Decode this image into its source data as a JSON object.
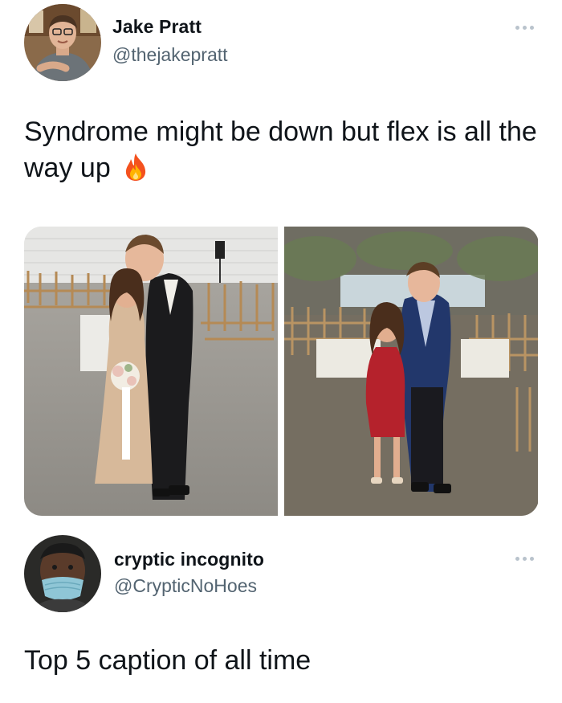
{
  "tweets": [
    {
      "author": {
        "name": "Jake Pratt",
        "handle": "@thejakepratt",
        "avatar_icon": "profile-photo"
      },
      "text": "Syndrome might be down but flex is all the way up",
      "text_emoji": "fire-emoji",
      "media": [
        {
          "icon": "photo-couple-tux-gold-dress"
        },
        {
          "icon": "photo-couple-blue-suit-red-dress"
        }
      ]
    },
    {
      "author": {
        "name": "cryptic incognito",
        "handle": "@CrypticNoHoes",
        "avatar_icon": "profile-photo-masked"
      },
      "text": "Top 5 caption of all time"
    }
  ],
  "colors": {
    "text_primary": "#0f1419",
    "text_secondary": "#536471",
    "more_dots": "#b9c3cc",
    "background": "#ffffff"
  }
}
